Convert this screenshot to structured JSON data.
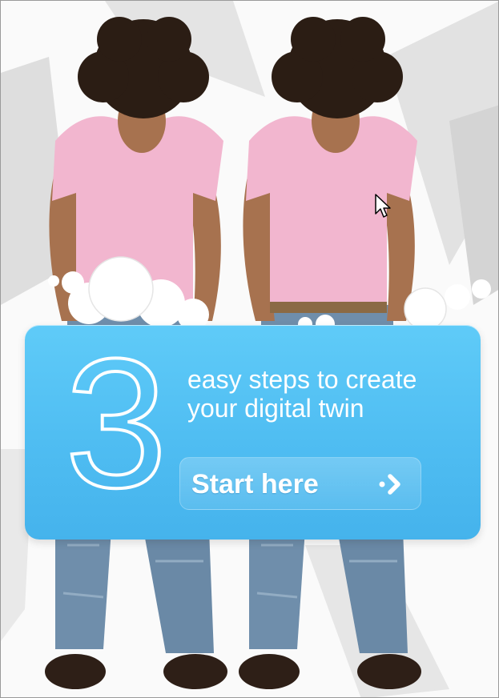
{
  "promo": {
    "number": "3",
    "headline_line1": "easy steps to create",
    "headline_line2": "your digital twin",
    "button_label": "Start here",
    "button_icon": "chevron-right-icon"
  },
  "colors": {
    "card_top": "#5fcbf8",
    "card_bottom": "#45b3ec",
    "shirt": "#f2b6cf",
    "jeans": "#6f8eab",
    "hair": "#2b1d14",
    "skin": "#a7724f",
    "shoes": "#2e1f17"
  },
  "icons": {
    "cursor": "mouse-pointer-icon"
  }
}
